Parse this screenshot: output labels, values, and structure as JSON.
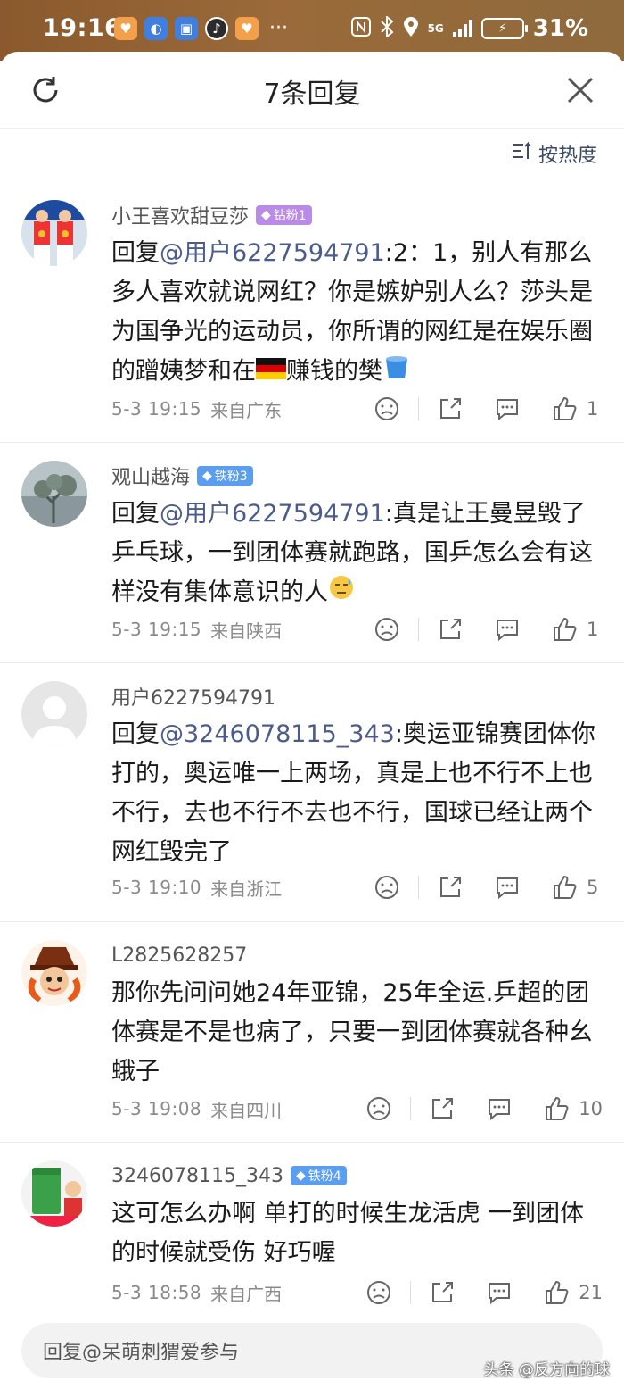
{
  "status_bar": {
    "time": "19:16",
    "dots": "···",
    "net": "5G",
    "battery": "31%"
  },
  "header": {
    "title": "7条回复",
    "sort_label": "按热度"
  },
  "comments": [
    {
      "username": "小王喜欢甜豆莎",
      "badge": "钻粉1",
      "mention": "@用户6227594791",
      "prefix": "回复",
      "body_a": ":2：1，别人有那么多人喜欢就说网红？你是嫉妒别人么？莎头是为国争光的运动员，你所谓的网红是在娱乐圈的蹭姨梦和在",
      "body_b": "赚钱的樊",
      "date": "5-3 19:15",
      "location": "来自广东",
      "likes": "1"
    },
    {
      "username": "观山越海",
      "badge": "铁粉3",
      "mention": "@用户6227594791",
      "prefix": "回复",
      "body_a": ":真是让王曼昱毁了乒乓球，一到团体赛就跑路，国乒怎么会有这样没有集体意识的人",
      "date": "5-3 19:15",
      "location": "来自陕西",
      "likes": "1"
    },
    {
      "username": "用户6227594791",
      "mention": "@3246078115_343",
      "prefix": "回复",
      "body_a": ":奥运亚锦赛团体你打的，奥运唯一上两场，真是上也不行不上也不行，去也不行不去也不行，国球已经让两个网红毁完了",
      "date": "5-3 19:10",
      "location": "来自浙江",
      "likes": "5"
    },
    {
      "username": "L2825628257",
      "body_a": "那你先问问她24年亚锦，25年全运.乒超的团体赛是不是也病了，只要一到团体赛就各种幺蛾子",
      "date": "5-3 19:08",
      "location": "来自四川",
      "likes": "10"
    },
    {
      "username": "3246078115_343",
      "badge": "铁粉4",
      "body_a": "这可怎么办啊  单打的时候生龙活虎 一到团体的时候就受伤 好巧喔",
      "date": "5-3 18:58",
      "location": "来自广西",
      "likes": "21"
    }
  ],
  "reply_bar": {
    "placeholder": "回复@呆萌刺猬爱参与"
  },
  "watermark": "头条 @反方向的球",
  "colors": {
    "mention": "#4b5c8c",
    "diamond_badge": "#b98ae6",
    "iron_badge": "#5b9ef0"
  }
}
